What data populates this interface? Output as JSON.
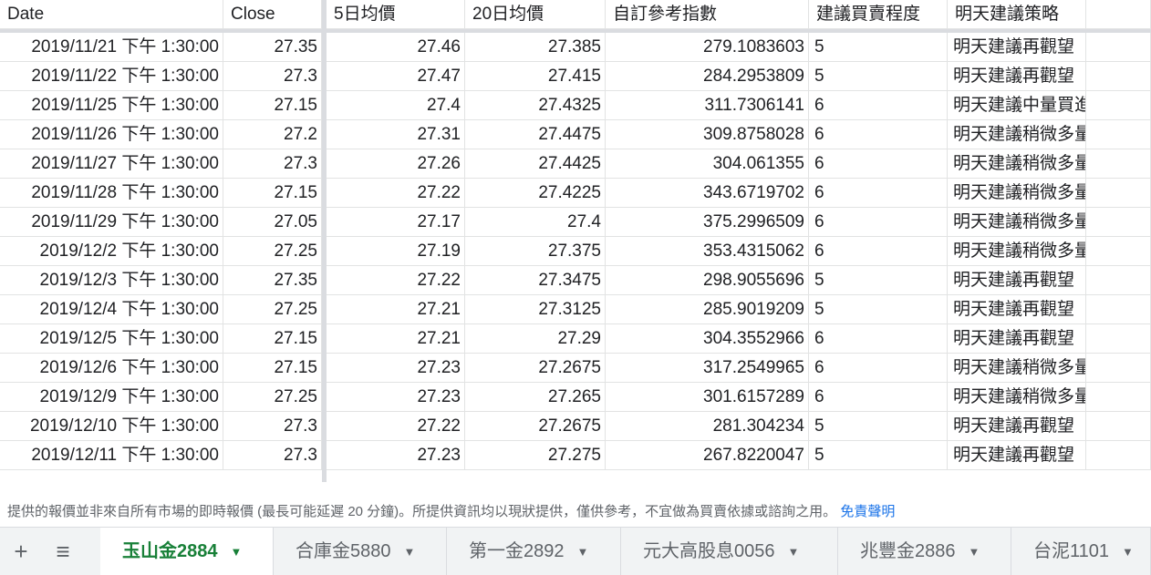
{
  "columns": [
    "Date",
    "Close",
    "5日均價",
    "20日均價",
    "自訂參考指數",
    "建議買賣程度",
    "明天建議策略"
  ],
  "rows": [
    [
      "2019/11/21 下午 1:30:00",
      "27.35",
      "27.46",
      "27.385",
      "279.1083603",
      "5",
      "明天建議再觀望"
    ],
    [
      "2019/11/22 下午 1:30:00",
      "27.3",
      "27.47",
      "27.415",
      "284.2953809",
      "5",
      "明天建議再觀望"
    ],
    [
      "2019/11/25 下午 1:30:00",
      "27.15",
      "27.4",
      "27.4325",
      "311.7306141",
      "6",
      "明天建議中量買進"
    ],
    [
      "2019/11/26 下午 1:30:00",
      "27.2",
      "27.31",
      "27.4475",
      "309.8758028",
      "6",
      "明天建議稍微多量買進"
    ],
    [
      "2019/11/27 下午 1:30:00",
      "27.3",
      "27.26",
      "27.4425",
      "304.061355",
      "6",
      "明天建議稍微多量買進"
    ],
    [
      "2019/11/28 下午 1:30:00",
      "27.15",
      "27.22",
      "27.4225",
      "343.6719702",
      "6",
      "明天建議稍微多量買進"
    ],
    [
      "2019/11/29 下午 1:30:00",
      "27.05",
      "27.17",
      "27.4",
      "375.2996509",
      "6",
      "明天建議稍微多量買進"
    ],
    [
      "2019/12/2 下午 1:30:00",
      "27.25",
      "27.19",
      "27.375",
      "353.4315062",
      "6",
      "明天建議稍微多量買進"
    ],
    [
      "2019/12/3 下午 1:30:00",
      "27.35",
      "27.22",
      "27.3475",
      "298.9055696",
      "5",
      "明天建議再觀望"
    ],
    [
      "2019/12/4 下午 1:30:00",
      "27.25",
      "27.21",
      "27.3125",
      "285.9019209",
      "5",
      "明天建議再觀望"
    ],
    [
      "2019/12/5 下午 1:30:00",
      "27.15",
      "27.21",
      "27.29",
      "304.3552966",
      "6",
      "明天建議再觀望"
    ],
    [
      "2019/12/6 下午 1:30:00",
      "27.15",
      "27.23",
      "27.2675",
      "317.2549965",
      "6",
      "明天建議稍微多量買進"
    ],
    [
      "2019/12/9 下午 1:30:00",
      "27.25",
      "27.23",
      "27.265",
      "301.6157289",
      "6",
      "明天建議稍微多量買進"
    ],
    [
      "2019/12/10 下午 1:30:00",
      "27.3",
      "27.22",
      "27.2675",
      "281.304234",
      "5",
      "明天建議再觀望"
    ],
    [
      "2019/12/11 下午 1:30:00",
      "27.3",
      "27.23",
      "27.275",
      "267.8220047",
      "5",
      "明天建議再觀望"
    ]
  ],
  "notice": {
    "text": "提供的報價並非來自所有市場的即時報價 (最長可能延遲 20 分鐘)。所提供資訊均以現狀提供，僅供參考，不宜做為買賣依據或諮詢之用。",
    "link": "免責聲明"
  },
  "toolbar": {
    "add_icon": "+",
    "menu_icon": "≡"
  },
  "tabs": [
    "玉山金2884",
    "合庫金5880",
    "第一金2892",
    "元大高股息0056",
    "兆豐金2886",
    "台泥1101"
  ],
  "active_tab": 0,
  "caret": "▼",
  "colors": {
    "active_tab": "#188038",
    "link": "#1a73e8",
    "gridline": "#e2e3e3",
    "frozen": "#dadce0"
  }
}
